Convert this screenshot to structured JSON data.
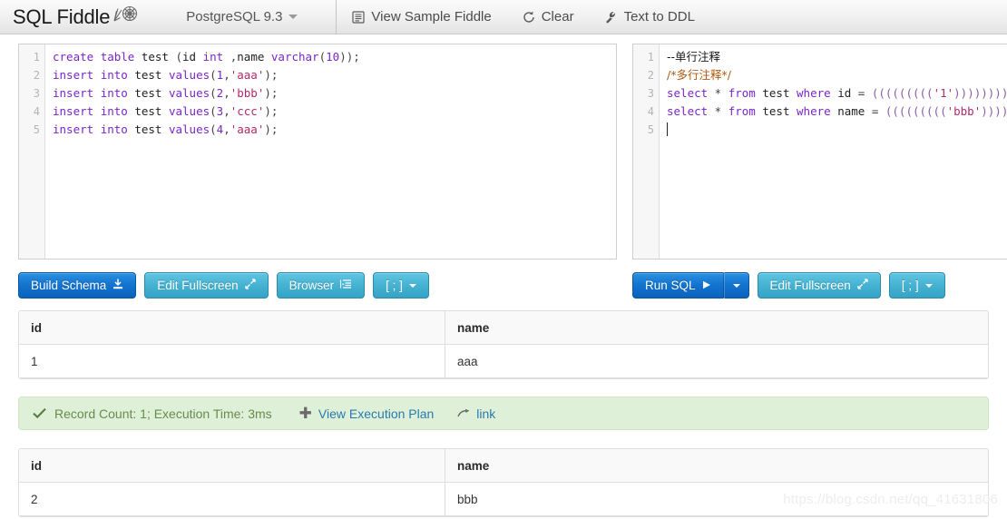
{
  "toolbar": {
    "brand": "SQL Fiddle",
    "logo_icon": "ammonite-fossil-icon",
    "db_engine": "PostgreSQL 9.3",
    "actions": [
      {
        "label": "View Sample Fiddle",
        "icon": "document-list-icon"
      },
      {
        "label": "Clear",
        "icon": "refresh-icon"
      },
      {
        "label": "Text to DDL",
        "icon": "wrench-icon"
      }
    ]
  },
  "left_editor": {
    "lines": [
      {
        "n": "1",
        "tokens": [
          {
            "t": "kw",
            "v": "create"
          },
          {
            "t": "punc",
            "v": " "
          },
          {
            "t": "kw",
            "v": "table"
          },
          {
            "t": "punc",
            "v": " "
          },
          {
            "t": "id",
            "v": "test"
          },
          {
            "t": "punc",
            "v": " ("
          },
          {
            "t": "id",
            "v": "id"
          },
          {
            "t": "punc",
            "v": " "
          },
          {
            "t": "kw",
            "v": "int"
          },
          {
            "t": "punc",
            "v": " ,"
          },
          {
            "t": "id",
            "v": "name"
          },
          {
            "t": "punc",
            "v": " "
          },
          {
            "t": "kw",
            "v": "varchar"
          },
          {
            "t": "punc",
            "v": "("
          },
          {
            "t": "num",
            "v": "10"
          },
          {
            "t": "punc",
            "v": "));"
          }
        ]
      },
      {
        "n": "2",
        "tokens": [
          {
            "t": "kw",
            "v": "insert"
          },
          {
            "t": "punc",
            "v": " "
          },
          {
            "t": "kw",
            "v": "into"
          },
          {
            "t": "punc",
            "v": " "
          },
          {
            "t": "id",
            "v": "test"
          },
          {
            "t": "punc",
            "v": " "
          },
          {
            "t": "kw",
            "v": "values"
          },
          {
            "t": "punc",
            "v": "("
          },
          {
            "t": "num",
            "v": "1"
          },
          {
            "t": "punc",
            "v": ","
          },
          {
            "t": "str",
            "v": "'aaa'"
          },
          {
            "t": "punc",
            "v": ");"
          }
        ]
      },
      {
        "n": "3",
        "tokens": [
          {
            "t": "kw",
            "v": "insert"
          },
          {
            "t": "punc",
            "v": " "
          },
          {
            "t": "kw",
            "v": "into"
          },
          {
            "t": "punc",
            "v": " "
          },
          {
            "t": "id",
            "v": "test"
          },
          {
            "t": "punc",
            "v": " "
          },
          {
            "t": "kw",
            "v": "values"
          },
          {
            "t": "punc",
            "v": "("
          },
          {
            "t": "num",
            "v": "2"
          },
          {
            "t": "punc",
            "v": ","
          },
          {
            "t": "str",
            "v": "'bbb'"
          },
          {
            "t": "punc",
            "v": ");"
          }
        ]
      },
      {
        "n": "4",
        "tokens": [
          {
            "t": "kw",
            "v": "insert"
          },
          {
            "t": "punc",
            "v": " "
          },
          {
            "t": "kw",
            "v": "into"
          },
          {
            "t": "punc",
            "v": " "
          },
          {
            "t": "id",
            "v": "test"
          },
          {
            "t": "punc",
            "v": " "
          },
          {
            "t": "kw",
            "v": "values"
          },
          {
            "t": "punc",
            "v": "("
          },
          {
            "t": "num",
            "v": "3"
          },
          {
            "t": "punc",
            "v": ","
          },
          {
            "t": "str",
            "v": "'ccc'"
          },
          {
            "t": "punc",
            "v": ");"
          }
        ]
      },
      {
        "n": "5",
        "tokens": [
          {
            "t": "kw",
            "v": "insert"
          },
          {
            "t": "punc",
            "v": " "
          },
          {
            "t": "kw",
            "v": "into"
          },
          {
            "t": "punc",
            "v": " "
          },
          {
            "t": "id",
            "v": "test"
          },
          {
            "t": "punc",
            "v": " "
          },
          {
            "t": "kw",
            "v": "values"
          },
          {
            "t": "punc",
            "v": "("
          },
          {
            "t": "num",
            "v": "4"
          },
          {
            "t": "punc",
            "v": ","
          },
          {
            "t": "str",
            "v": "'aaa'"
          },
          {
            "t": "punc",
            "v": ");"
          }
        ]
      }
    ]
  },
  "right_editor": {
    "lines": [
      {
        "n": "1",
        "tokens": [
          {
            "t": "cmt1 cjk",
            "v": "--单行注释"
          }
        ]
      },
      {
        "n": "2",
        "tokens": [
          {
            "t": "cmt2 cjk",
            "v": "/*多行注释*/"
          }
        ]
      },
      {
        "n": "3",
        "tokens": [
          {
            "t": "kw",
            "v": "select"
          },
          {
            "t": "punc",
            "v": " * "
          },
          {
            "t": "kw",
            "v": "from"
          },
          {
            "t": "punc",
            "v": " "
          },
          {
            "t": "id",
            "v": "test"
          },
          {
            "t": "punc",
            "v": " "
          },
          {
            "t": "kw",
            "v": "where"
          },
          {
            "t": "punc",
            "v": " "
          },
          {
            "t": "id",
            "v": "id"
          },
          {
            "t": "punc",
            "v": " = "
          },
          {
            "t": "par",
            "v": "((((((((("
          },
          {
            "t": "str",
            "v": "'1'"
          },
          {
            "t": "par",
            "v": ")))))))))"
          },
          {
            "t": "punc",
            "v": ";"
          }
        ]
      },
      {
        "n": "4",
        "tokens": [
          {
            "t": "kw",
            "v": "select"
          },
          {
            "t": "punc",
            "v": " * "
          },
          {
            "t": "kw",
            "v": "from"
          },
          {
            "t": "punc",
            "v": " "
          },
          {
            "t": "id",
            "v": "test"
          },
          {
            "t": "punc",
            "v": " "
          },
          {
            "t": "kw",
            "v": "where"
          },
          {
            "t": "punc",
            "v": " "
          },
          {
            "t": "id",
            "v": "name"
          },
          {
            "t": "punc",
            "v": " = "
          },
          {
            "t": "par",
            "v": "((((((((("
          },
          {
            "t": "str",
            "v": "'bbb'"
          },
          {
            "t": "par",
            "v": ")))))))))"
          },
          {
            "t": "punc",
            "v": ";"
          }
        ]
      },
      {
        "n": "5",
        "tokens": [],
        "caret": true
      }
    ]
  },
  "left_buttons": [
    {
      "label": "Build Schema",
      "icon": "download-icon",
      "style": "primary"
    },
    {
      "label": "Edit Fullscreen",
      "icon": "expand-arrows-icon",
      "style": "info"
    },
    {
      "label": "Browser",
      "icon": "indent-list-icon",
      "style": "info"
    },
    {
      "label": "[ ; ]",
      "icon": "caret-down-icon",
      "style": "info"
    }
  ],
  "right_buttons": {
    "run": {
      "label": "Run SQL",
      "icon": "play-icon",
      "style": "primary"
    },
    "run_toggle_icon": "caret-down-icon",
    "others": [
      {
        "label": "Edit Fullscreen",
        "icon": "expand-arrows-icon",
        "style": "info"
      },
      {
        "label": "[ ; ]",
        "icon": "caret-down-icon",
        "style": "info"
      }
    ]
  },
  "results": [
    {
      "columns": [
        "id",
        "name"
      ],
      "rows": [
        [
          "1",
          "aaa"
        ]
      ]
    },
    {
      "columns": [
        "id",
        "name"
      ],
      "rows": [
        [
          "2",
          "bbb"
        ]
      ]
    }
  ],
  "status": {
    "check_icon": "checkmark-icon",
    "text": "Record Count: 1; Execution Time: 3ms",
    "plan_icon": "plus-icon",
    "plan_label": "View Execution Plan",
    "link_icon": "arrow-right-icon",
    "link_label": "link"
  },
  "watermark": "https://blog.csdn.net/qq_41631806",
  "colors": {
    "primary_button": "#1273cf",
    "info_button": "#45b2d2",
    "status_bg": "#dff0d8",
    "status_text": "#6a8a4e",
    "link": "#2a7ab0",
    "keyword": "#7a26c9",
    "string": "#b02a6b",
    "comment_block": "#b05a10"
  }
}
